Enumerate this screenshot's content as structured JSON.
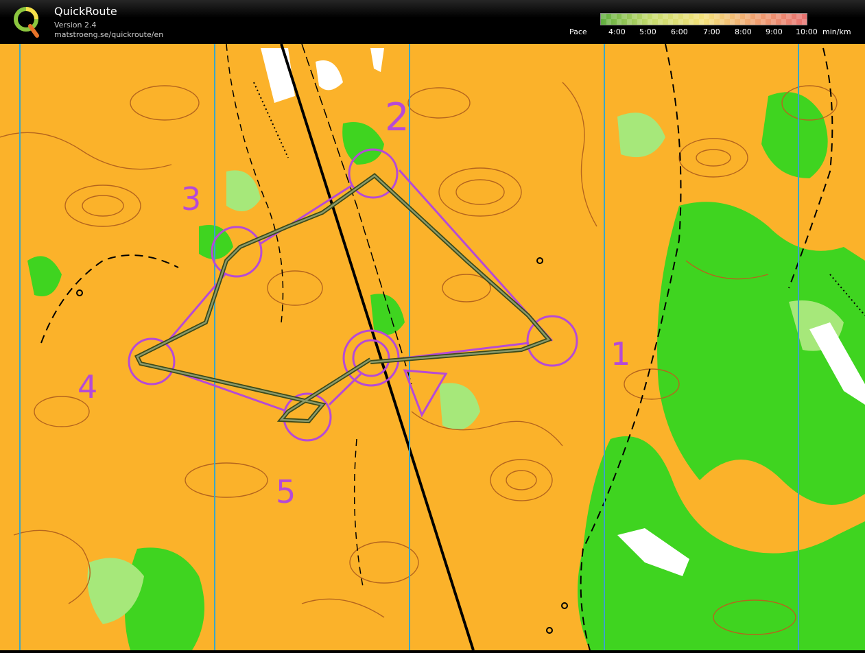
{
  "header": {
    "app_name": "QuickRoute",
    "version": "Version 2.4",
    "url": "matstroeng.se/quickroute/en",
    "pace_label": "Pace",
    "pace_ticks": [
      "4:00",
      "5:00",
      "6:00",
      "7:00",
      "8:00",
      "9:00",
      "10:00"
    ],
    "pace_unit": "min/km",
    "pace_gradient": [
      "#5fae3e",
      "#c8dc6e",
      "#f3e07a",
      "#f0a070",
      "#e87070"
    ]
  },
  "map": {
    "course_color": "#b64ad6",
    "route_color": "#556b2f",
    "north_line_color": "#3aa6c8",
    "controls": [
      {
        "label": "1"
      },
      {
        "label": "2"
      },
      {
        "label": "3"
      },
      {
        "label": "4"
      },
      {
        "label": "5"
      }
    ]
  }
}
